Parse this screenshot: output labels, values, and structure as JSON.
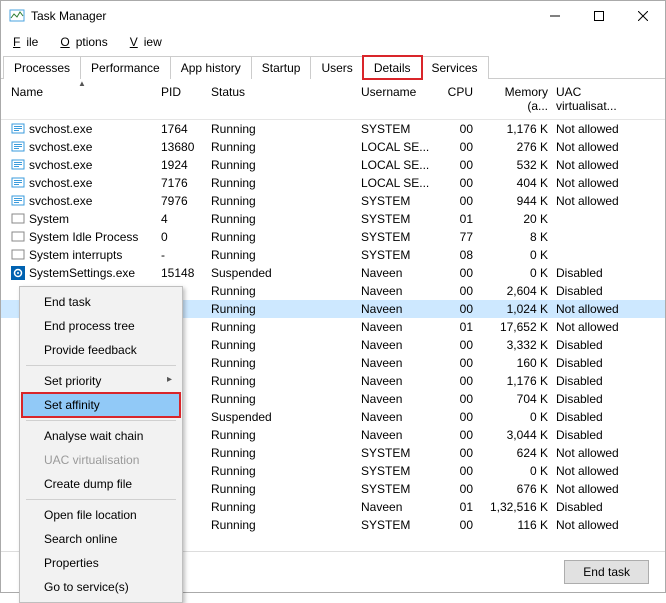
{
  "window": {
    "title": "Task Manager"
  },
  "menubar": [
    "File",
    "Options",
    "View"
  ],
  "tabs": [
    {
      "label": "Processes"
    },
    {
      "label": "Performance"
    },
    {
      "label": "App history"
    },
    {
      "label": "Startup"
    },
    {
      "label": "Users"
    },
    {
      "label": "Details",
      "active": true,
      "highlight": true
    },
    {
      "label": "Services"
    }
  ],
  "columns": {
    "name": "Name",
    "pid": "PID",
    "status": "Status",
    "user": "Username",
    "cpu": "CPU",
    "mem": "Memory (a...",
    "uac": "UAC virtualisat..."
  },
  "sort_column": "name",
  "rows": [
    {
      "icon": "svc",
      "name": "svchost.exe",
      "pid": "1764",
      "status": "Running",
      "user": "SYSTEM",
      "cpu": "00",
      "mem": "1,176 K",
      "uac": "Not allowed"
    },
    {
      "icon": "svc",
      "name": "svchost.exe",
      "pid": "13680",
      "status": "Running",
      "user": "LOCAL SE...",
      "cpu": "00",
      "mem": "276 K",
      "uac": "Not allowed"
    },
    {
      "icon": "svc",
      "name": "svchost.exe",
      "pid": "1924",
      "status": "Running",
      "user": "LOCAL SE...",
      "cpu": "00",
      "mem": "532 K",
      "uac": "Not allowed"
    },
    {
      "icon": "svc",
      "name": "svchost.exe",
      "pid": "7176",
      "status": "Running",
      "user": "LOCAL SE...",
      "cpu": "00",
      "mem": "404 K",
      "uac": "Not allowed"
    },
    {
      "icon": "svc",
      "name": "svchost.exe",
      "pid": "7976",
      "status": "Running",
      "user": "SYSTEM",
      "cpu": "00",
      "mem": "944 K",
      "uac": "Not allowed"
    },
    {
      "icon": "sys",
      "name": "System",
      "pid": "4",
      "status": "Running",
      "user": "SYSTEM",
      "cpu": "01",
      "mem": "20 K",
      "uac": ""
    },
    {
      "icon": "sys",
      "name": "System Idle Process",
      "pid": "0",
      "status": "Running",
      "user": "SYSTEM",
      "cpu": "77",
      "mem": "8 K",
      "uac": ""
    },
    {
      "icon": "sys",
      "name": "System interrupts",
      "pid": "-",
      "status": "Running",
      "user": "SYSTEM",
      "cpu": "08",
      "mem": "0 K",
      "uac": ""
    },
    {
      "icon": "gear",
      "name": "SystemSettings.exe",
      "pid": "15148",
      "status": "Suspended",
      "user": "Naveen",
      "cpu": "00",
      "mem": "0 K",
      "uac": "Disabled"
    },
    {
      "icon": "",
      "name": "",
      "pid": "",
      "status": "Running",
      "user": "Naveen",
      "cpu": "00",
      "mem": "2,604 K",
      "uac": "Disabled"
    },
    {
      "icon": "",
      "name": "",
      "pid": "",
      "status": "Running",
      "user": "Naveen",
      "cpu": "00",
      "mem": "1,024 K",
      "uac": "Not allowed",
      "selected": true
    },
    {
      "icon": "",
      "name": "",
      "pid": "",
      "status": "Running",
      "user": "Naveen",
      "cpu": "01",
      "mem": "17,652 K",
      "uac": "Not allowed"
    },
    {
      "icon": "",
      "name": "",
      "pid": "",
      "status": "Running",
      "user": "Naveen",
      "cpu": "00",
      "mem": "3,332 K",
      "uac": "Disabled"
    },
    {
      "icon": "",
      "name": "",
      "pid": "",
      "status": "Running",
      "user": "Naveen",
      "cpu": "00",
      "mem": "160 K",
      "uac": "Disabled"
    },
    {
      "icon": "",
      "name": "",
      "pid": "",
      "status": "Running",
      "user": "Naveen",
      "cpu": "00",
      "mem": "1,176 K",
      "uac": "Disabled"
    },
    {
      "icon": "",
      "name": "",
      "pid": "",
      "status": "Running",
      "user": "Naveen",
      "cpu": "00",
      "mem": "704 K",
      "uac": "Disabled"
    },
    {
      "icon": "",
      "name": "",
      "pid": "",
      "status": "Suspended",
      "user": "Naveen",
      "cpu": "00",
      "mem": "0 K",
      "uac": "Disabled"
    },
    {
      "icon": "",
      "name": "",
      "pid": "",
      "status": "Running",
      "user": "Naveen",
      "cpu": "00",
      "mem": "3,044 K",
      "uac": "Disabled"
    },
    {
      "icon": "",
      "name": "",
      "pid": "",
      "status": "Running",
      "user": "SYSTEM",
      "cpu": "00",
      "mem": "624 K",
      "uac": "Not allowed"
    },
    {
      "icon": "",
      "name": "",
      "pid": "",
      "status": "Running",
      "user": "SYSTEM",
      "cpu": "00",
      "mem": "0 K",
      "uac": "Not allowed"
    },
    {
      "icon": "",
      "name": "",
      "pid": "",
      "status": "Running",
      "user": "SYSTEM",
      "cpu": "00",
      "mem": "676 K",
      "uac": "Not allowed"
    },
    {
      "icon": "",
      "name": "",
      "pid": "",
      "status": "Running",
      "user": "Naveen",
      "cpu": "01",
      "mem": "1,32,516 K",
      "uac": "Disabled"
    },
    {
      "icon": "",
      "name": "",
      "pid": "",
      "status": "Running",
      "user": "SYSTEM",
      "cpu": "00",
      "mem": "116 K",
      "uac": "Not allowed"
    }
  ],
  "context_menu": [
    {
      "label": "End task"
    },
    {
      "label": "End process tree"
    },
    {
      "label": "Provide feedback"
    },
    {
      "sep": true
    },
    {
      "label": "Set priority",
      "submenu": true
    },
    {
      "label": "Set affinity",
      "highlight": true
    },
    {
      "sep": true
    },
    {
      "label": "Analyse wait chain"
    },
    {
      "label": "UAC virtualisation",
      "disabled": true
    },
    {
      "label": "Create dump file"
    },
    {
      "sep": true
    },
    {
      "label": "Open file location"
    },
    {
      "label": "Search online"
    },
    {
      "label": "Properties"
    },
    {
      "label": "Go to service(s)"
    }
  ],
  "footer": {
    "end_task": "End task"
  },
  "icons": {
    "svc_color": "#3a9bdc",
    "gear_color": "#0062b1"
  }
}
